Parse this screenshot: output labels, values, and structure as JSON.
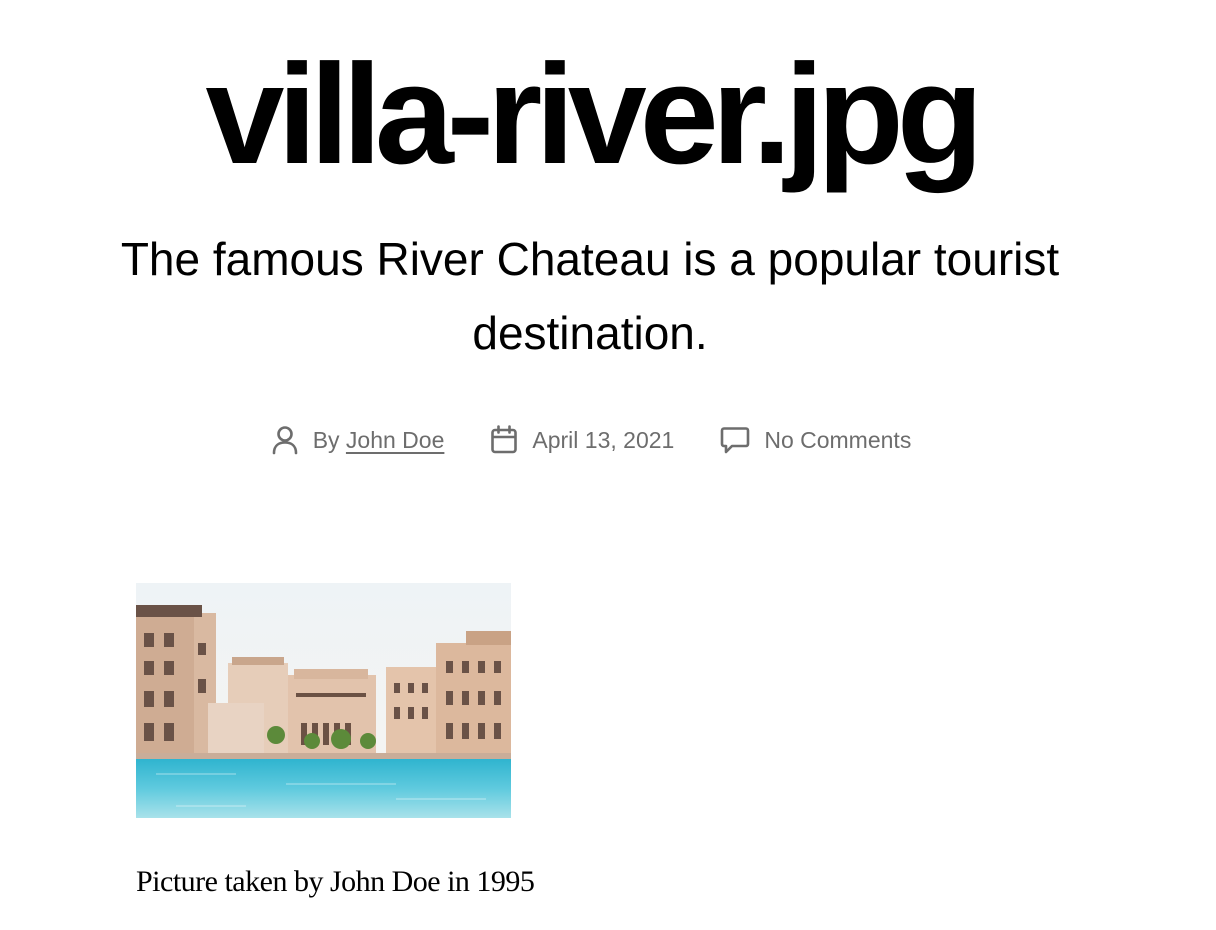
{
  "post": {
    "title": "villa-river.jpg",
    "excerpt": "The famous River Chateau is a popular tourist destination.",
    "meta": {
      "by_prefix": "By",
      "author": "John Doe",
      "date": "April 13, 2021",
      "comments": "No Comments"
    },
    "image": {
      "alt": "villa river photo"
    },
    "caption": "Picture taken by John Doe in 1995"
  },
  "icons": {
    "author": "person-icon",
    "date": "calendar-icon",
    "comments": "comment-bubble-icon"
  },
  "colors": {
    "text": "#000000",
    "meta": "#6d6d6d",
    "background": "#ffffff"
  }
}
